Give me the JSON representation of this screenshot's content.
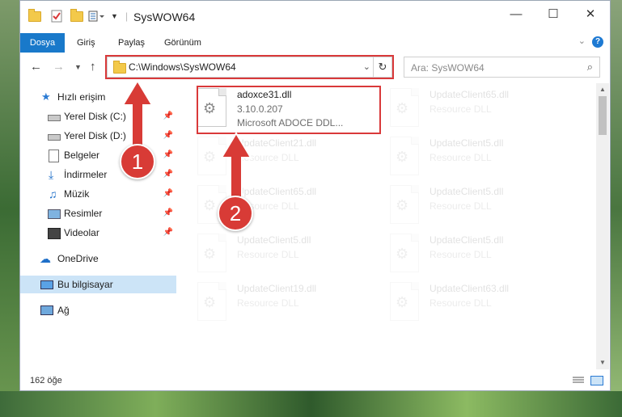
{
  "window": {
    "title": "SysWOW64",
    "controls": {
      "minimize": "—",
      "maximize": "☐",
      "close": "✕"
    }
  },
  "ribbon": {
    "tabs": [
      "Dosya",
      "Giriş",
      "Paylaş",
      "Görünüm"
    ],
    "help": "?"
  },
  "address_bar": {
    "path": "C:\\Windows\\SysWOW64",
    "search_placeholder": "Ara: SysWOW64"
  },
  "nav_pane": {
    "quick_access": "Hızlı erişim",
    "items": [
      {
        "label": "Yerel Disk (C:)",
        "icon": "drive-icon",
        "pinned": true
      },
      {
        "label": "Yerel Disk (D:)",
        "icon": "drive-icon",
        "pinned": true
      },
      {
        "label": "Belgeler",
        "icon": "documents-icon",
        "pinned": true
      },
      {
        "label": "İndirmeler",
        "icon": "downloads-icon",
        "pinned": true
      },
      {
        "label": "Müzik",
        "icon": "music-icon",
        "pinned": true
      },
      {
        "label": "Resimler",
        "icon": "pictures-icon",
        "pinned": true
      },
      {
        "label": "Videolar",
        "icon": "videos-icon",
        "pinned": true
      }
    ],
    "onedrive": "OneDrive",
    "this_pc": "Bu bilgisayar",
    "network": "Ağ"
  },
  "files": [
    {
      "name": "adoxce31.dll",
      "version": "3.10.0.207",
      "description": "Microsoft ADOCE DDL..."
    },
    {
      "name": "UpdateClient65.dll",
      "description": "Resource DLL"
    },
    {
      "name": "UpdateClient21.dll",
      "description": "Resource DLL"
    },
    {
      "name": "UpdateClient5.dll",
      "description": "Resource DLL"
    },
    {
      "name": "UpdateClient65.dll",
      "description": "Resource DLL"
    },
    {
      "name": "UpdateClient5.dll",
      "description": "Resource DLL"
    },
    {
      "name": "UpdateClient5.dll",
      "description": "Resource DLL"
    },
    {
      "name": "UpdateClient5.dll",
      "description": "Resource DLL"
    },
    {
      "name": "UpdateClient19.dll",
      "description": "Resource DLL"
    },
    {
      "name": "UpdateClient63.dll",
      "description": "Resource DLL"
    }
  ],
  "status": {
    "item_count": "162 öğe"
  },
  "callouts": {
    "step1": "1",
    "step2": "2"
  },
  "colors": {
    "accent": "#1979ca",
    "highlight": "#d9393a",
    "callout": "#d83b36"
  }
}
